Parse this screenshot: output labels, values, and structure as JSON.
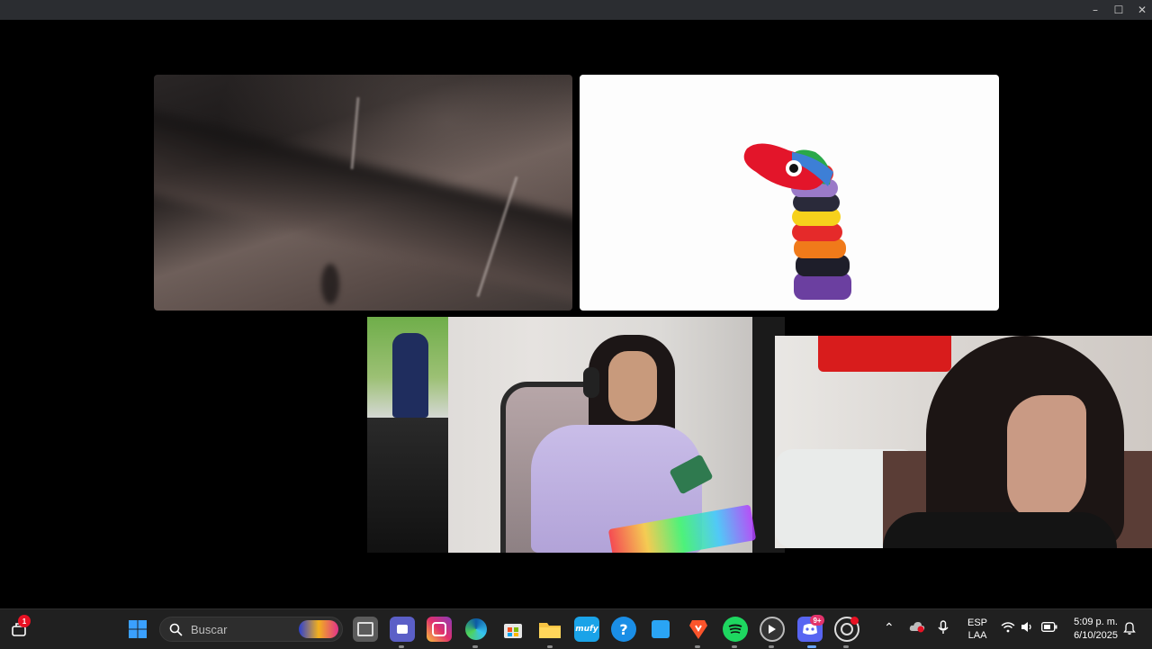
{
  "window": {
    "controls": {
      "minimize": "–",
      "maximize": "☐",
      "close": "✕"
    }
  },
  "stage": {
    "tiles": [
      {
        "name": "participant-video-1",
        "content": "blurred-camera-feed"
      },
      {
        "name": "participant-video-2",
        "content": "sock-puppet-avatar"
      },
      {
        "name": "participant-video-3",
        "content": "person-with-headphones-on-phone"
      },
      {
        "name": "participant-video-4",
        "content": "person-close-up"
      }
    ]
  },
  "taskbar": {
    "notification_count": "1",
    "search_placeholder": "Buscar",
    "apps": [
      "start-icon",
      "task-view-icon",
      "teams-icon",
      "instagram-icon",
      "edge-icon",
      "store-icon",
      "file-explorer-icon",
      "mufy-icon",
      "help-icon",
      "app-icon",
      "brave-icon",
      "spotify-icon",
      "media-player-icon",
      "discord-icon",
      "obs-icon"
    ],
    "mufy_label": "mufy",
    "help_label": "?",
    "discord_badge": "9+",
    "language": {
      "line1": "ESP",
      "line2": "LAA"
    },
    "clock": {
      "time": "5:09 p. m.",
      "date": "6/10/2025"
    }
  },
  "colors": {
    "taskbar_bg": "#202020",
    "titlebar_bg": "#2b2d31",
    "badge_red": "#e81123",
    "discord_badge": "#e2336b"
  }
}
